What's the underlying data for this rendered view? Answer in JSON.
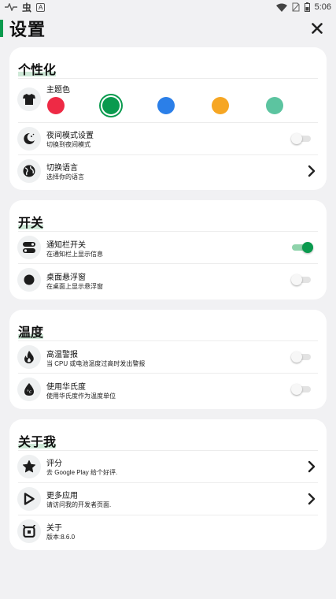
{
  "status_bar": {
    "time": "5:06",
    "app_glyph": "虫",
    "badge": "A"
  },
  "header": {
    "title": "设置"
  },
  "colors": {
    "accent": "#0a9a4e",
    "swatches": [
      "#ee2a45",
      "#0a9a4e",
      "#2b7fe8",
      "#f6a623",
      "#5cc4a0"
    ]
  },
  "personalize": {
    "title": "个性化",
    "theme_color": {
      "label": "主题色",
      "selected_index": 1
    },
    "night_mode": {
      "title": "夜间模式设置",
      "subtitle": "切换到夜间模式",
      "enabled": false
    },
    "language": {
      "title": "切换语言",
      "subtitle": "选择你的语言"
    }
  },
  "switches": {
    "title": "开关",
    "notification": {
      "title": "通知栏开关",
      "subtitle": "在通知栏上显示信息",
      "enabled": true
    },
    "floating": {
      "title": "桌面悬浮窗",
      "subtitle": "在桌面上显示悬浮窗",
      "enabled": false
    }
  },
  "temperature": {
    "title": "温度",
    "high_temp": {
      "title": "高温警报",
      "subtitle": "当 CPU 或电池温度过高时发出警报",
      "enabled": false
    },
    "fahrenheit": {
      "title": "使用华氏度",
      "subtitle": "使用华氏度作为温度单位",
      "enabled": false
    }
  },
  "about": {
    "title": "关于我",
    "rate": {
      "title": "评分",
      "subtitle": "去 Google Play 给个好评."
    },
    "more_apps": {
      "title": "更多应用",
      "subtitle": "请访问我的开发者页面."
    },
    "about": {
      "title": "关于",
      "subtitle": "版本:8.6.0"
    }
  }
}
